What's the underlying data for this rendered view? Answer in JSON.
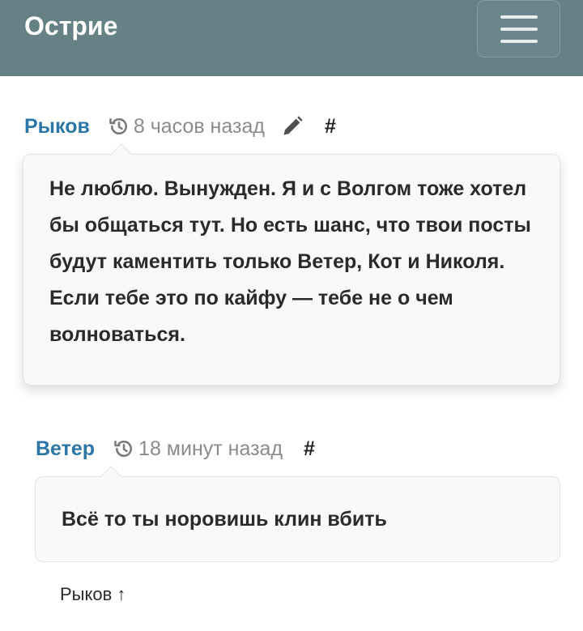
{
  "header": {
    "brand": "Острие"
  },
  "comments": [
    {
      "author": "Рыков",
      "time": "8 часов назад",
      "anchor": "#",
      "text": "Не люблю. Вынужден. Я и с Волгом тоже хотел бы общаться тут. Но есть шанс, что твои посты будут каментить только Ветер, Кот и Николя. Если тебе это по кайфу — тебе не о чем волноваться.",
      "editable": true
    },
    {
      "author": "Ветер",
      "time": "18 минут назад",
      "anchor": "#",
      "text": "Всё то ты норовишь клин вбить",
      "reply_to": "Рыков ↑"
    }
  ],
  "icons": {
    "history": "history-icon",
    "edit": "pencil-icon",
    "menu": "hamburger-icon"
  },
  "colors": {
    "navbar": "#658186",
    "author": "#2b76a6",
    "muted": "#8b8b8b",
    "bubble_bg": "#f8f9fa"
  }
}
